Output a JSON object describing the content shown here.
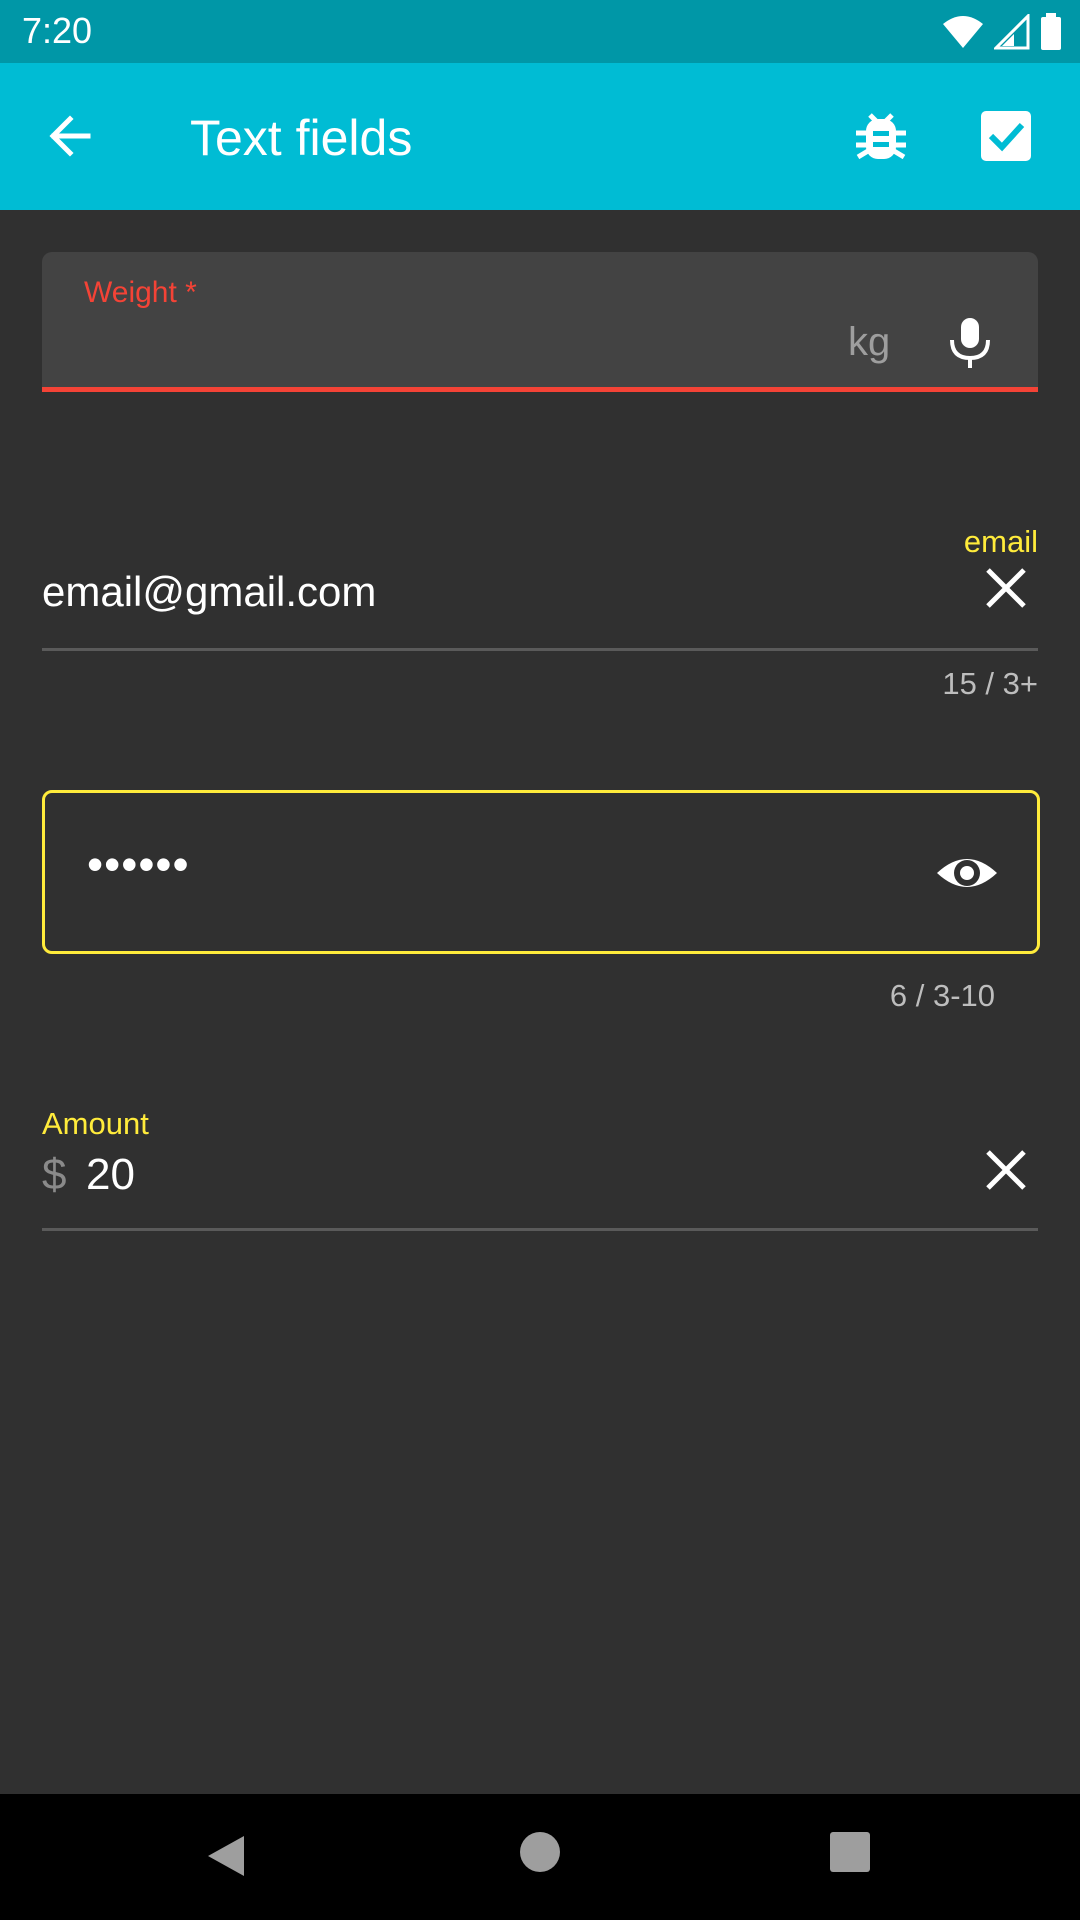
{
  "status_bar": {
    "time": "7:20",
    "icons": [
      "wifi-icon",
      "signal-icon",
      "battery-icon"
    ]
  },
  "app_bar": {
    "title": "Text fields",
    "back_icon": "arrow-back-icon",
    "actions": [
      "bug-icon",
      "check-box-icon"
    ]
  },
  "weight_field": {
    "label": "Weight *",
    "value": "",
    "suffix": "kg",
    "trailing_icon": "mic-icon",
    "error_color": "#f44336"
  },
  "email_field": {
    "floating_label": "email",
    "value": "email@gmail.com",
    "trailing_icon": "close-icon",
    "counter": "15 / 3+"
  },
  "password_field": {
    "value": "••••••",
    "trailing_icon": "eye-icon",
    "counter": "6 / 3-10",
    "outline_color": "#ffeb3b"
  },
  "amount_field": {
    "label": "Amount",
    "prefix": "$",
    "value": "20",
    "trailing_icon": "close-icon"
  },
  "colors": {
    "app_bar": "#00BCD4",
    "status_bar": "#0097A7",
    "background": "#303030",
    "accent": "#ffeb3b"
  }
}
